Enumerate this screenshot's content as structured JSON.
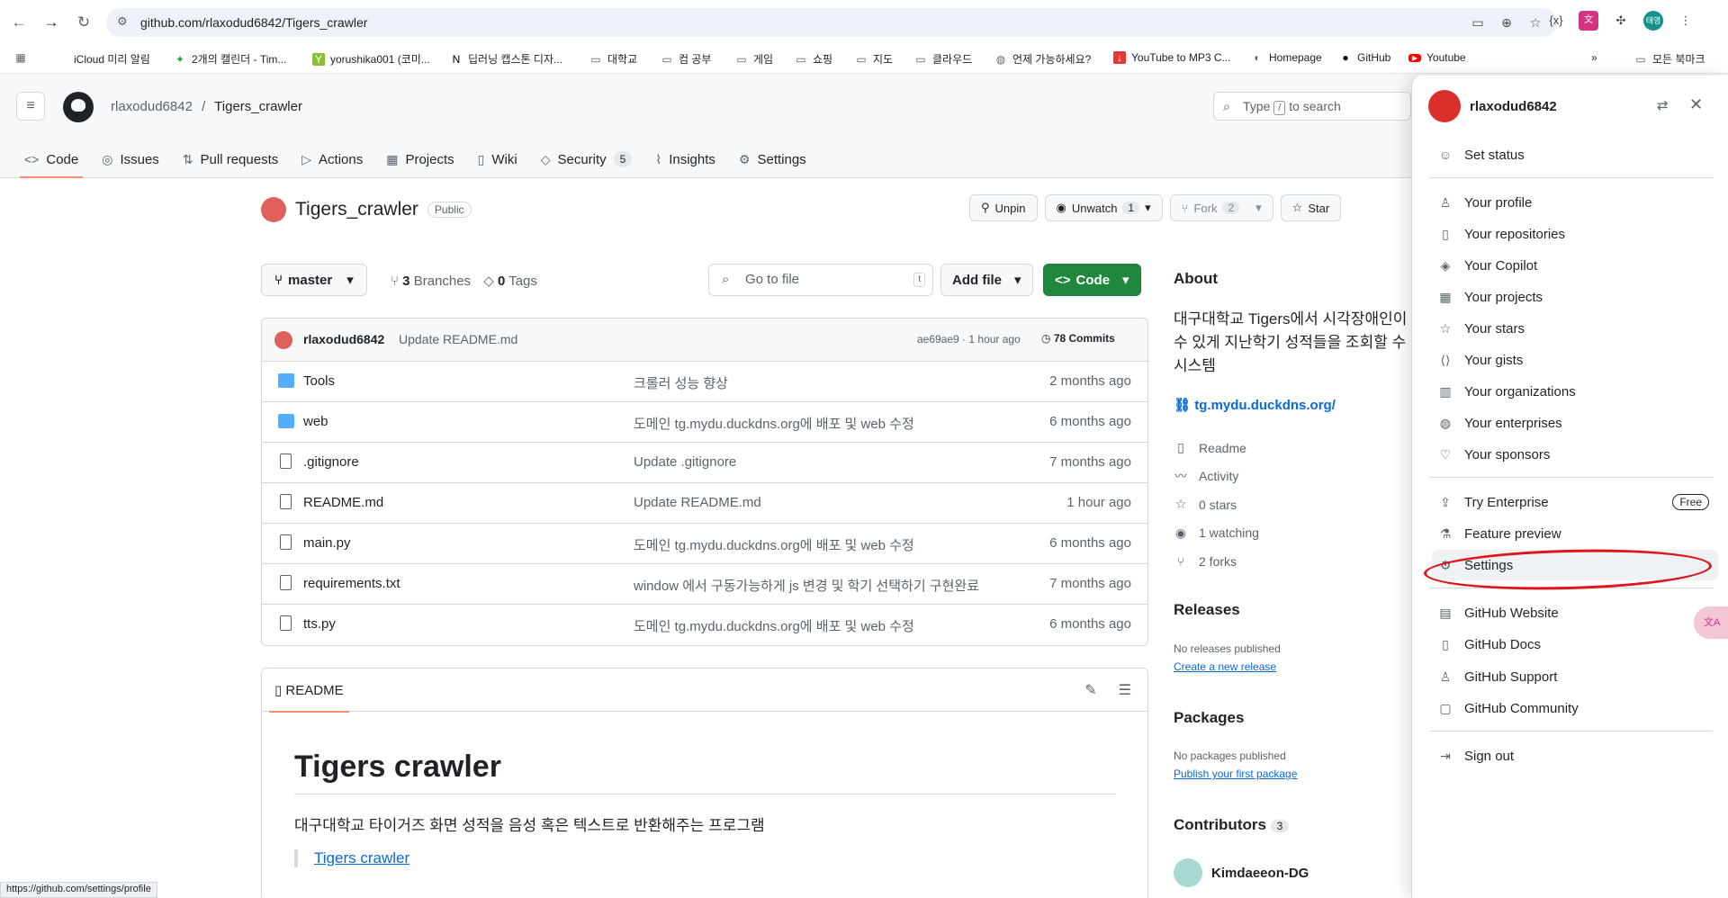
{
  "browser": {
    "url": "github.com/rlaxodud6842/Tigers_crawler",
    "bookmarks": [
      "iCloud 미리 알림",
      "2개의 캘린더 - Tim...",
      "yorushika001 (코미...",
      "딥러닝 캡스톤 디자...",
      "대학교",
      "컴 공부",
      "게임",
      "쇼핑",
      "지도",
      "클라우드",
      "언제 가능하세요?",
      "YouTube to MP3 C...",
      "Homepage",
      "GitHub",
      "Youtube"
    ],
    "all_bookmarks": "모든 북마크",
    "profile_badge": "태영",
    "ext_badge": "{x}",
    "status_url": "https://github.com/settings/profile"
  },
  "header": {
    "owner": "rlaxodud6842",
    "repo": "Tigers_crawler",
    "search_prefix": "Type",
    "search_key": "/",
    "search_suffix": "to search"
  },
  "tabs": [
    {
      "label": "Code",
      "icon": "<>"
    },
    {
      "label": "Issues",
      "icon": "◎"
    },
    {
      "label": "Pull requests",
      "icon": "⇅"
    },
    {
      "label": "Actions",
      "icon": "▷"
    },
    {
      "label": "Projects",
      "icon": "▦"
    },
    {
      "label": "Wiki",
      "icon": "▯"
    },
    {
      "label": "Security",
      "icon": "◇",
      "count": "5"
    },
    {
      "label": "Insights",
      "icon": "⌇"
    },
    {
      "label": "Settings",
      "icon": "⚙"
    }
  ],
  "repo": {
    "name": "Tigers_crawler",
    "visibility": "Public",
    "unpin": "Unpin",
    "unwatch": "Unwatch",
    "watch_count": "1",
    "fork": "Fork",
    "fork_count": "2",
    "star": "Star",
    "branch": "master",
    "branches_count": "3",
    "branches_label": "Branches",
    "tags_count": "0",
    "tags_label": "Tags",
    "goto_placeholder": "Go to file",
    "goto_key": "t",
    "add_file": "Add file",
    "code_button": "Code"
  },
  "commit": {
    "user": "rlaxodud6842",
    "message": "Update README.md",
    "hash_time": "ae69ae9 · 1 hour ago",
    "commits": "78 Commits"
  },
  "files": [
    {
      "name": "Tools",
      "type": "folder",
      "commit": "크롤러 성능 향상",
      "time": "2 months ago"
    },
    {
      "name": "web",
      "type": "folder",
      "commit": "도메인 tg.mydu.duckdns.org에 배포 및 web 수정",
      "time": "6 months ago"
    },
    {
      "name": ".gitignore",
      "type": "file",
      "commit": "Update .gitignore",
      "time": "7 months ago"
    },
    {
      "name": "README.md",
      "type": "file",
      "commit": "Update README.md",
      "time": "1 hour ago"
    },
    {
      "name": "main.py",
      "type": "file",
      "commit": "도메인 tg.mydu.duckdns.org에 배포 및 web 수정",
      "time": "6 months ago"
    },
    {
      "name": "requirements.txt",
      "type": "file",
      "commit": "window 에서 구동가능하게 js 변경 및 학기 선택하기 구현완료",
      "time": "7 months ago"
    },
    {
      "name": "tts.py",
      "type": "file",
      "commit": "도메인 tg.mydu.duckdns.org에 배포 및 web 수정",
      "time": "6 months ago"
    }
  ],
  "readme": {
    "tab": "README",
    "title": "Tigers crawler",
    "paragraph": "대구대학교 타이거즈 화면 성적을 음성 혹은 텍스트로 반환해주는 프로그램",
    "link": "Tigers crawler"
  },
  "about": {
    "heading": "About",
    "description": "대구대학교 Tigers에서 시각장애인이 할 수 있게 지난학기 성적들을 조회할 수 있는 시스템",
    "link": "tg.mydu.duckdns.org/",
    "meta": [
      {
        "icon": "▯",
        "label": "Readme"
      },
      {
        "icon": "〰",
        "label": "Activity"
      },
      {
        "icon": "☆",
        "label": "0 stars"
      },
      {
        "icon": "◉",
        "label": "1 watching"
      },
      {
        "icon": "⑂",
        "label": "2 forks"
      }
    ],
    "releases_heading": "Releases",
    "releases_none": "No releases published",
    "releases_link": "Create a new release",
    "packages_heading": "Packages",
    "packages_none": "No packages published",
    "packages_link": "Publish your first package",
    "contributors_heading": "Contributors",
    "contributors_count": "3",
    "contributor": "Kimdaeeon-DG"
  },
  "menu": {
    "username": "rlaxodud6842",
    "items": [
      {
        "label": "Set status",
        "icon": "☺"
      },
      {
        "label": "Your profile",
        "icon": "♙"
      },
      {
        "label": "Your repositories",
        "icon": "▯"
      },
      {
        "label": "Your Copilot",
        "icon": "◈"
      },
      {
        "label": "Your projects",
        "icon": "▦"
      },
      {
        "label": "Your stars",
        "icon": "☆"
      },
      {
        "label": "Your gists",
        "icon": "⟨⟩"
      },
      {
        "label": "Your organizations",
        "icon": "▥"
      },
      {
        "label": "Your enterprises",
        "icon": "◍"
      },
      {
        "label": "Your sponsors",
        "icon": "♡"
      },
      {
        "label": "Try Enterprise",
        "icon": "⇪"
      },
      {
        "label": "Feature preview",
        "icon": "⚗"
      },
      {
        "label": "Settings",
        "icon": "⚙"
      },
      {
        "label": "GitHub Website",
        "icon": "▤"
      },
      {
        "label": "GitHub Docs",
        "icon": "▯"
      },
      {
        "label": "GitHub Support",
        "icon": "♙"
      },
      {
        "label": "GitHub Community",
        "icon": "▢"
      },
      {
        "label": "Sign out",
        "icon": "⇥"
      }
    ],
    "free_badge": "Free",
    "accent": "#e0141b"
  }
}
